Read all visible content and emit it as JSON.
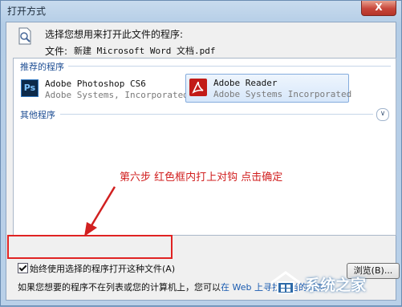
{
  "window": {
    "title": "打开方式",
    "close_label": "X"
  },
  "header": {
    "prompt": "选择您想用来打开此文件的程序:",
    "file_label": "文件:",
    "file_name": "新建 Microsoft Word 文档.pdf"
  },
  "recommended": {
    "label": "推荐的程序",
    "apps": [
      {
        "name": "Adobe Photoshop CS6",
        "publisher": "Adobe Systems, Incorporated",
        "icon": "photoshop-icon",
        "icon_text": "Ps",
        "selected": false
      },
      {
        "name": "Adobe Reader",
        "publisher": "Adobe Systems Incorporated",
        "icon": "adobe-reader-icon",
        "selected": true
      }
    ]
  },
  "other": {
    "label": "其他程序"
  },
  "annotation": "第六步 红色框内打上对钩 点击确定",
  "always_use": {
    "label": "始终使用选择的程序打开这种文件(A)",
    "checked": true
  },
  "browse_button": "浏览(B)...",
  "footer": {
    "text": "如果您想要的程序不在列表或您的计算机上，您可以",
    "link": "在 Web 上寻找适当的程序",
    "end": "。"
  },
  "watermark": {
    "text": "系统之家"
  },
  "colors": {
    "annotation_red": "#d12020",
    "link_blue": "#1a5bb0",
    "group_label": "#1f4f94"
  }
}
